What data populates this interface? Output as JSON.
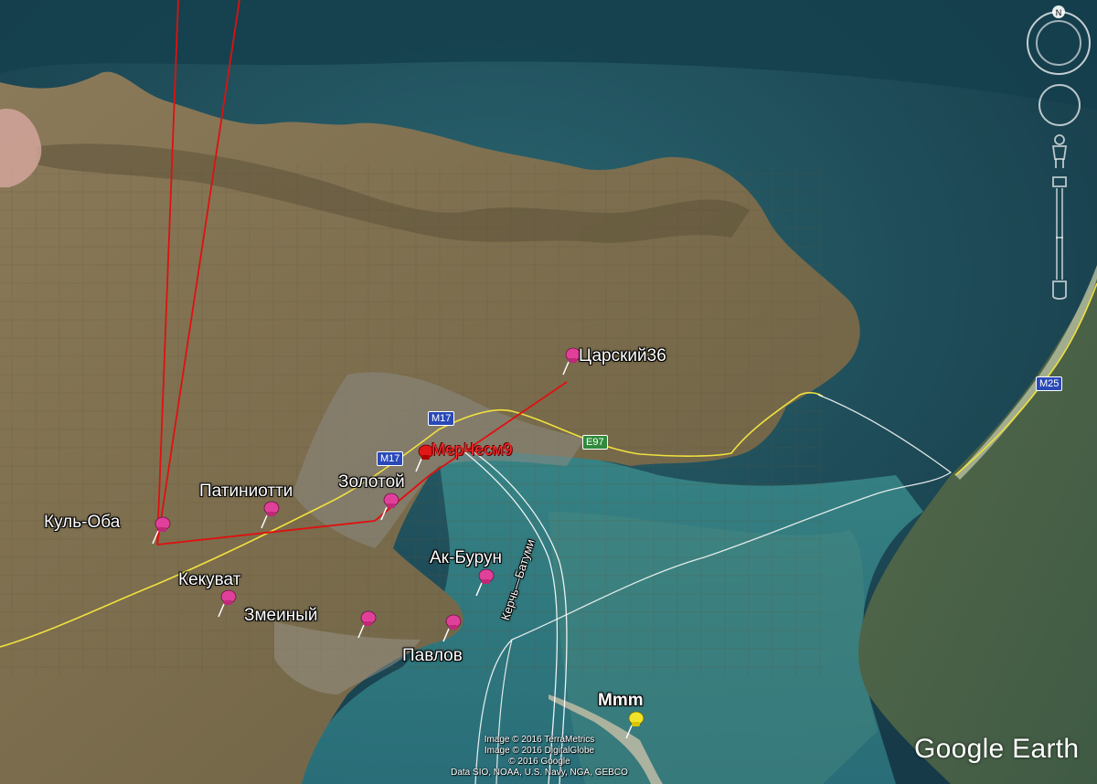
{
  "places": [
    {
      "id": "kul-oba",
      "label": "Куль-Оба"
    },
    {
      "id": "patiniotti",
      "label": "Патиниотти"
    },
    {
      "id": "zolotoy",
      "label": "Золотой"
    },
    {
      "id": "tsarsky",
      "label": "Царский36"
    },
    {
      "id": "ak-burun",
      "label": "Ак-Бурун"
    },
    {
      "id": "kekuvat",
      "label": "Кекуват"
    },
    {
      "id": "zmeiny",
      "label": "Змеиный"
    },
    {
      "id": "pavlov",
      "label": "Павлов"
    },
    {
      "id": "mmm",
      "label": "Mmm"
    },
    {
      "id": "mesm",
      "label": "МерЧесм9"
    }
  ],
  "roads": {
    "m17_a": "M17",
    "m17_b": "M17",
    "e97": "E97",
    "m25": "M25",
    "channel": "Керчь—Батуми"
  },
  "compass": {
    "north": "N"
  },
  "credits": [
    "Image © 2016 TerraMetrics",
    "Image © 2016 DigitalGlobe",
    "© 2016 Google",
    "Data SIO, NOAA, U.S. Navy, NGA, GEBCO"
  ],
  "brand": "Google Earth",
  "colors": {
    "pin_pink": "#e0409a",
    "pin_red": "#e01818",
    "pin_yellow": "#f2e22a",
    "road_yellow": "#f0e040",
    "measure_red": "#e01010"
  },
  "icons": {
    "pin": "pushpin-icon",
    "compass": "compass-icon",
    "look": "look-joystick-icon",
    "street_view": "pegman-icon",
    "zoom": "zoom-slider-icon"
  }
}
